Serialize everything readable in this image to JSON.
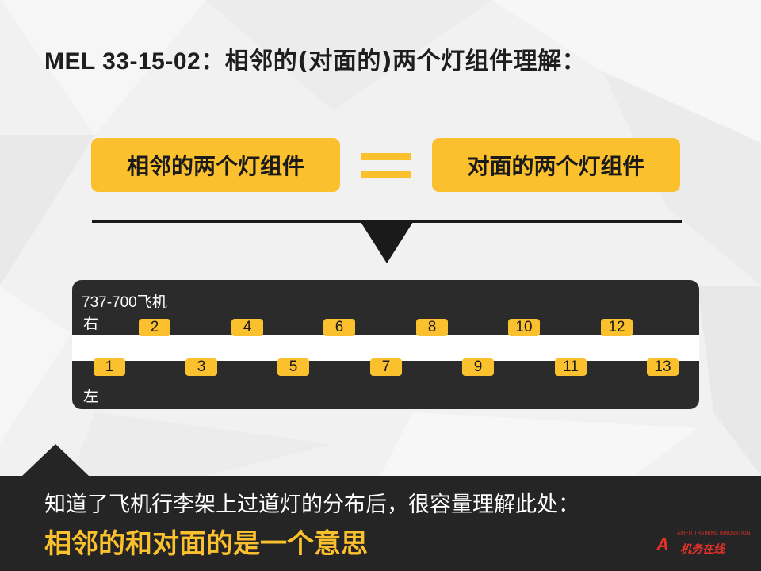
{
  "slide": {
    "title_code": "MEL 33-15-02",
    "title_sep": "：",
    "title_text": "相邻的(对面的)两个灯组件理解：",
    "pill_left": "相邻的两个灯组件",
    "pill_right": "对面的两个灯组件",
    "equals_icon": "equals-icon",
    "arrow_icon": "down-triangle-icon"
  },
  "diagram": {
    "aircraft_label": "737-700飞机",
    "right_side_label": "右",
    "left_side_label": "左",
    "right_lights": [
      "2",
      "4",
      "6",
      "8",
      "10",
      "12"
    ],
    "left_lights": [
      "1",
      "3",
      "5",
      "7",
      "9",
      "11",
      "13"
    ]
  },
  "footer": {
    "line1": "知道了飞机行李架上过道灯的分布后，很容量理解此处：",
    "line2": "相邻的和对面的是一个意思"
  },
  "logo": {
    "mark": "A",
    "tagline": "AIRFIT TRAINING INNOVATION",
    "name": "机务在线"
  },
  "colors": {
    "accent": "#fbc02d",
    "dark": "#252525",
    "logo_red": "#e8312a"
  }
}
